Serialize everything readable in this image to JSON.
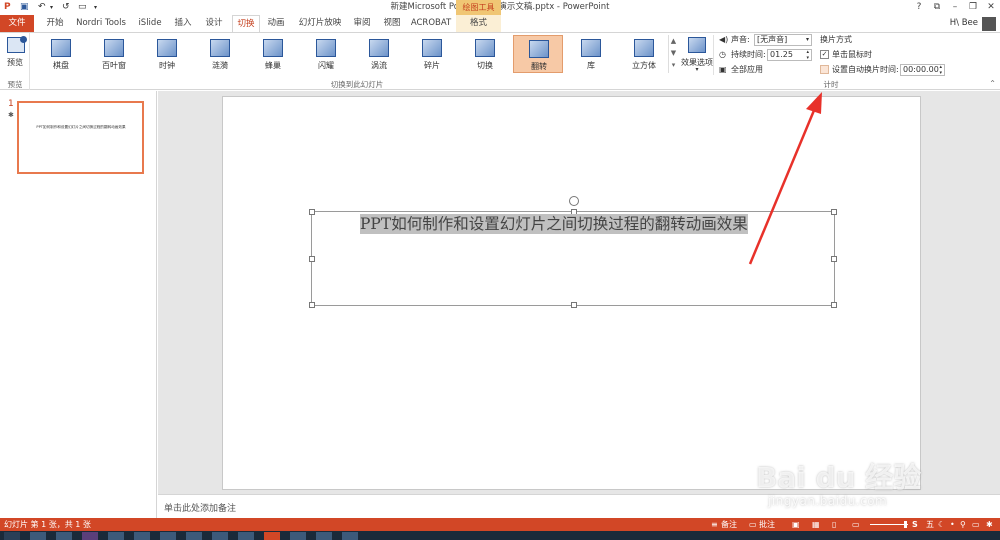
{
  "titlebar": {
    "title": "新建Microsoft PowerPoint 演示文稿.pptx - PowerPoint",
    "tools_group_title": "绘图工具",
    "help": "?",
    "restore_ribbon": "⧉",
    "minimize": "–",
    "maximize": "❐",
    "close": "✕"
  },
  "tabs": {
    "file": "文件",
    "items": [
      "开始",
      "Nordri Tools",
      "iSlide",
      "插入",
      "设计",
      "切换",
      "动画",
      "幻灯片放映",
      "审阅",
      "视图",
      "ACROBAT"
    ],
    "format": "格式",
    "user": "H\\ Bee"
  },
  "ribbon": {
    "preview_label": "预览",
    "preview_group_label": "预览",
    "transitions": [
      "棋盘",
      "百叶窗",
      "时钟",
      "涟漪",
      "蜂巢",
      "闪耀",
      "涡流",
      "碎片",
      "切换",
      "翻转",
      "库",
      "立方体"
    ],
    "selected_transition": "翻转",
    "effect_options_label": "效果选项",
    "switch_group_label": "切换到此幻灯片",
    "timing": {
      "sound_label": "声音:",
      "sound_value": "[无声音]",
      "duration_label": "持续时间:",
      "duration_value": "01.25",
      "apply_all_label": "全部应用",
      "advance_label": "换片方式",
      "on_click_label": "单击鼠标时",
      "auto_label": "设置自动换片时间:",
      "auto_value": "00:00.00",
      "group_label": "计时"
    }
  },
  "thumbnails": {
    "slide_number": "1",
    "star": "✱",
    "thumb_text": "PPT如何制作和设置幻灯片之间切换过程的翻转动画效果"
  },
  "slide": {
    "title": "PPT如何制作和设置幻灯片之间切换过程的翻转动画效果"
  },
  "notes": {
    "placeholder": "单击此处添加备注"
  },
  "statusbar": {
    "left": "幻灯片 第 1 张，共 1 张",
    "notes": "备注",
    "comments": "批注"
  },
  "watermark": {
    "logo": "Bai du 经验",
    "url": "jingyan.baidu.com"
  },
  "colors": {
    "accent": "#d24726",
    "selected_transition_bg": "#f7c9a6",
    "arrow": "#e8312a"
  }
}
